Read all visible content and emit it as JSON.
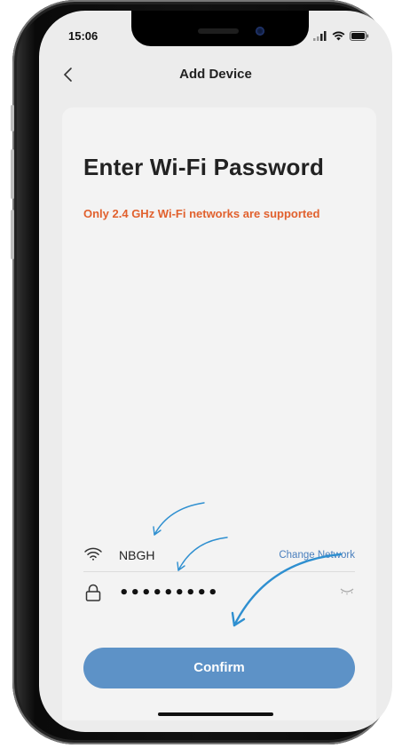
{
  "status_bar": {
    "time": "15:06"
  },
  "nav": {
    "title": "Add Device",
    "back_icon": "chevron-left-icon"
  },
  "page": {
    "heading": "Enter Wi-Fi Password",
    "warning": "Only 2.4 GHz Wi-Fi networks are supported"
  },
  "network": {
    "ssid": "NBGH",
    "change_label": "Change Network",
    "icon": "wifi-icon"
  },
  "password": {
    "value": "•••••••••",
    "icon": "lock-icon",
    "toggle_icon": "eye-closed-icon"
  },
  "actions": {
    "confirm_label": "Confirm"
  },
  "colors": {
    "accent": "#5d92c7",
    "warning": "#e1612e",
    "link": "#4a7fbd",
    "annotation_arrow": "#2e8fd0"
  }
}
